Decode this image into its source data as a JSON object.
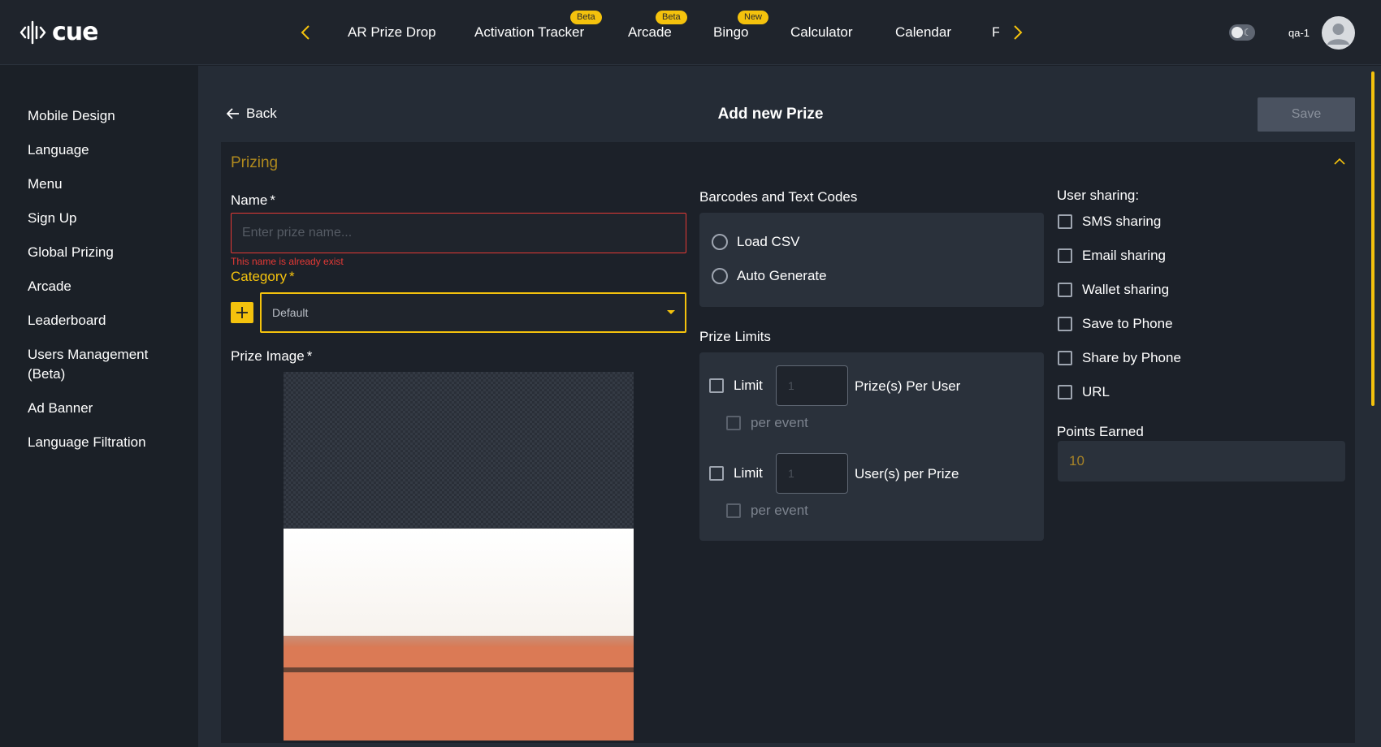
{
  "app": {
    "logo_text": "cue"
  },
  "nav": {
    "tabs": [
      {
        "label": "AR Prize Drop",
        "badge": ""
      },
      {
        "label": "Activation Tracker",
        "badge": "Beta"
      },
      {
        "label": "Arcade",
        "badge": "Beta"
      },
      {
        "label": "Bingo",
        "badge": "New"
      },
      {
        "label": "Calculator",
        "badge": ""
      },
      {
        "label": "Calendar",
        "badge": ""
      },
      {
        "label": "F",
        "badge": ""
      }
    ]
  },
  "user": {
    "name": "qa-1"
  },
  "sidebar": {
    "items": [
      {
        "label": "Mobile Design"
      },
      {
        "label": "Language"
      },
      {
        "label": "Menu"
      },
      {
        "label": "Sign Up"
      },
      {
        "label": "Global Prizing"
      },
      {
        "label": "Arcade"
      },
      {
        "label": "Leaderboard"
      },
      {
        "label": "Users Management (Beta)"
      },
      {
        "label": "Ad Banner"
      },
      {
        "label": "Language Filtration"
      }
    ]
  },
  "header": {
    "back_label": "Back",
    "title": "Add new Prize",
    "save_label": "Save"
  },
  "section": {
    "title": "Prizing"
  },
  "form": {
    "name": {
      "label": "Name",
      "required": "*",
      "placeholder": "Enter prize name...",
      "value": "",
      "error": "This name is already exist"
    },
    "category": {
      "label": "Category",
      "required": "*",
      "value": "Default"
    },
    "prize_image": {
      "label": "Prize Image",
      "required": "*"
    }
  },
  "codes": {
    "label": "Barcodes and Text Codes",
    "options": [
      {
        "label": "Load CSV"
      },
      {
        "label": "Auto Generate"
      }
    ]
  },
  "limits": {
    "label": "Prize Limits",
    "limit_label": "Limit",
    "per_user": {
      "placeholder": "1",
      "suffix": "Prize(s) Per User",
      "per_event": "per event"
    },
    "per_prize": {
      "placeholder": "1",
      "suffix": "User(s) per Prize",
      "per_event": "per event"
    }
  },
  "sharing": {
    "label": "User sharing:",
    "options": [
      {
        "label": "SMS sharing"
      },
      {
        "label": "Email sharing"
      },
      {
        "label": "Wallet sharing"
      },
      {
        "label": "Save to Phone"
      },
      {
        "label": "Share by Phone"
      },
      {
        "label": "URL"
      }
    ]
  },
  "points": {
    "label": "Points Earned",
    "value": "10"
  },
  "colors": {
    "accent": "#f4c20d",
    "error": "#e53935",
    "background": "#1b2027"
  }
}
